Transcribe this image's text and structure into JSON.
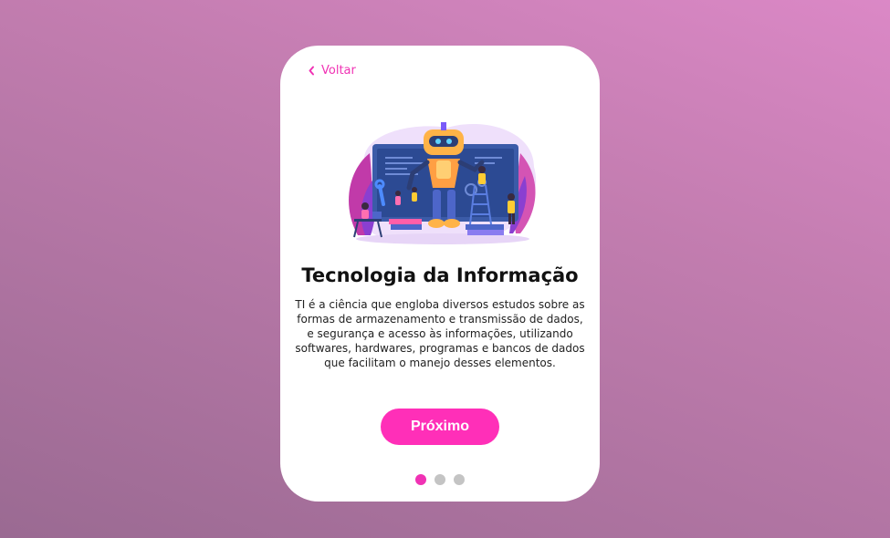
{
  "nav": {
    "back_label": "Voltar",
    "back_icon": "chevron-left-icon"
  },
  "slide": {
    "illustration": "robot-it-team-illustration",
    "title": "Tecnologia da Informação",
    "description": "TI é a ciência que engloba diversos estudos sobre as formas de armazenamento e transmissão de dados, e segurança e acesso às informações, utilizando softwares, hardwares, programas e bancos de dados que facilitam o manejo desses elementos."
  },
  "actions": {
    "next_label": "Próximo"
  },
  "pagination": {
    "total": 3,
    "active_index": 0
  },
  "colors": {
    "accent": "#f032b4",
    "button": "#ff2fb8",
    "dot_inactive": "#c4c4c4",
    "card": "#ffffff"
  }
}
